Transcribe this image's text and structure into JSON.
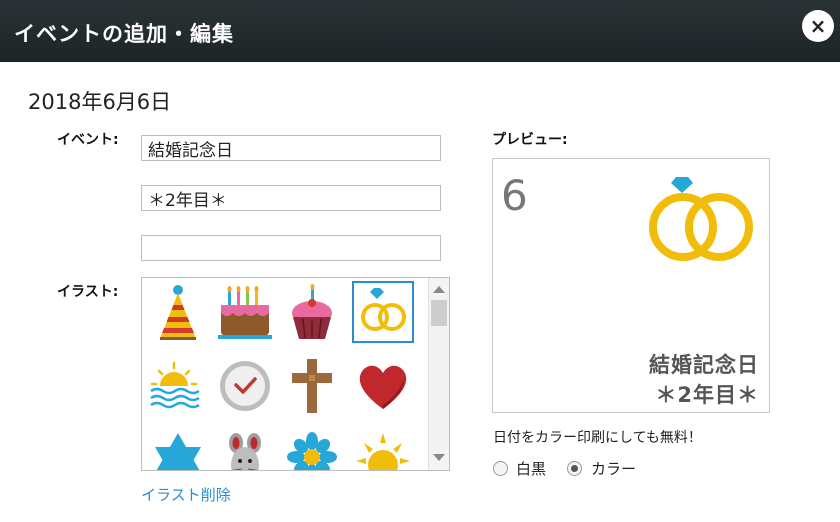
{
  "dialog": {
    "title": "イベントの追加・編集",
    "close_label": "×"
  },
  "date_heading": "2018年6月6日",
  "event": {
    "label": "イベント:",
    "line1": "結婚記念日",
    "line2": "＊2年目＊",
    "line3": ""
  },
  "illustration": {
    "label": "イラスト:",
    "delete_label": "イラスト削除",
    "icons": [
      "party-hat-icon",
      "birthday-cake-icon",
      "cupcake-icon",
      "wedding-rings-icon",
      "sunrise-icon",
      "checkmark-icon",
      "cross-icon",
      "heart-icon",
      "star-of-david-icon",
      "mouse-icon",
      "flower-icon",
      "sun-icon"
    ],
    "selected_icon": "wedding-rings-icon"
  },
  "preview": {
    "label": "プレビュー:",
    "day_number": "6",
    "text_line1": "結婚記念日",
    "text_line2": "＊2年目＊",
    "icon": "wedding-rings-icon"
  },
  "print_note": "日付をカラー印刷にしても無料！",
  "color_mode": {
    "options": [
      "白黒",
      "カラー"
    ],
    "selected": "カラー"
  },
  "colors": {
    "title_bar": "#1c2427",
    "link": "#2a8dd2",
    "ring_gold": "#f2bd0a",
    "gem_blue": "#27a6d8"
  }
}
